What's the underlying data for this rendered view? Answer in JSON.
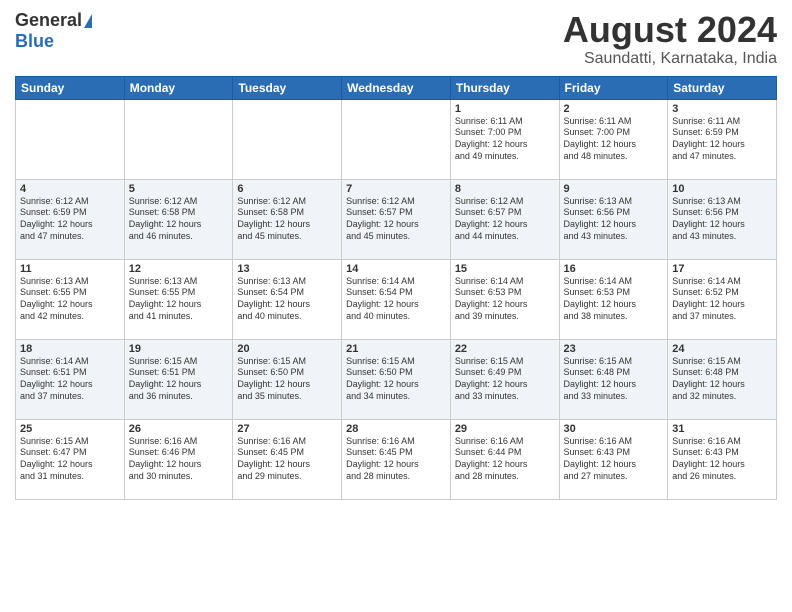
{
  "header": {
    "logo_general": "General",
    "logo_blue": "Blue",
    "month_title": "August 2024",
    "location": "Saundatti, Karnataka, India"
  },
  "days_of_week": [
    "Sunday",
    "Monday",
    "Tuesday",
    "Wednesday",
    "Thursday",
    "Friday",
    "Saturday"
  ],
  "weeks": [
    [
      {
        "day": "",
        "info": ""
      },
      {
        "day": "",
        "info": ""
      },
      {
        "day": "",
        "info": ""
      },
      {
        "day": "",
        "info": ""
      },
      {
        "day": "1",
        "info": "Sunrise: 6:11 AM\nSunset: 7:00 PM\nDaylight: 12 hours\nand 49 minutes."
      },
      {
        "day": "2",
        "info": "Sunrise: 6:11 AM\nSunset: 7:00 PM\nDaylight: 12 hours\nand 48 minutes."
      },
      {
        "day": "3",
        "info": "Sunrise: 6:11 AM\nSunset: 6:59 PM\nDaylight: 12 hours\nand 47 minutes."
      }
    ],
    [
      {
        "day": "4",
        "info": "Sunrise: 6:12 AM\nSunset: 6:59 PM\nDaylight: 12 hours\nand 47 minutes."
      },
      {
        "day": "5",
        "info": "Sunrise: 6:12 AM\nSunset: 6:58 PM\nDaylight: 12 hours\nand 46 minutes."
      },
      {
        "day": "6",
        "info": "Sunrise: 6:12 AM\nSunset: 6:58 PM\nDaylight: 12 hours\nand 45 minutes."
      },
      {
        "day": "7",
        "info": "Sunrise: 6:12 AM\nSunset: 6:57 PM\nDaylight: 12 hours\nand 45 minutes."
      },
      {
        "day": "8",
        "info": "Sunrise: 6:12 AM\nSunset: 6:57 PM\nDaylight: 12 hours\nand 44 minutes."
      },
      {
        "day": "9",
        "info": "Sunrise: 6:13 AM\nSunset: 6:56 PM\nDaylight: 12 hours\nand 43 minutes."
      },
      {
        "day": "10",
        "info": "Sunrise: 6:13 AM\nSunset: 6:56 PM\nDaylight: 12 hours\nand 43 minutes."
      }
    ],
    [
      {
        "day": "11",
        "info": "Sunrise: 6:13 AM\nSunset: 6:55 PM\nDaylight: 12 hours\nand 42 minutes."
      },
      {
        "day": "12",
        "info": "Sunrise: 6:13 AM\nSunset: 6:55 PM\nDaylight: 12 hours\nand 41 minutes."
      },
      {
        "day": "13",
        "info": "Sunrise: 6:13 AM\nSunset: 6:54 PM\nDaylight: 12 hours\nand 40 minutes."
      },
      {
        "day": "14",
        "info": "Sunrise: 6:14 AM\nSunset: 6:54 PM\nDaylight: 12 hours\nand 40 minutes."
      },
      {
        "day": "15",
        "info": "Sunrise: 6:14 AM\nSunset: 6:53 PM\nDaylight: 12 hours\nand 39 minutes."
      },
      {
        "day": "16",
        "info": "Sunrise: 6:14 AM\nSunset: 6:53 PM\nDaylight: 12 hours\nand 38 minutes."
      },
      {
        "day": "17",
        "info": "Sunrise: 6:14 AM\nSunset: 6:52 PM\nDaylight: 12 hours\nand 37 minutes."
      }
    ],
    [
      {
        "day": "18",
        "info": "Sunrise: 6:14 AM\nSunset: 6:51 PM\nDaylight: 12 hours\nand 37 minutes."
      },
      {
        "day": "19",
        "info": "Sunrise: 6:15 AM\nSunset: 6:51 PM\nDaylight: 12 hours\nand 36 minutes."
      },
      {
        "day": "20",
        "info": "Sunrise: 6:15 AM\nSunset: 6:50 PM\nDaylight: 12 hours\nand 35 minutes."
      },
      {
        "day": "21",
        "info": "Sunrise: 6:15 AM\nSunset: 6:50 PM\nDaylight: 12 hours\nand 34 minutes."
      },
      {
        "day": "22",
        "info": "Sunrise: 6:15 AM\nSunset: 6:49 PM\nDaylight: 12 hours\nand 33 minutes."
      },
      {
        "day": "23",
        "info": "Sunrise: 6:15 AM\nSunset: 6:48 PM\nDaylight: 12 hours\nand 33 minutes."
      },
      {
        "day": "24",
        "info": "Sunrise: 6:15 AM\nSunset: 6:48 PM\nDaylight: 12 hours\nand 32 minutes."
      }
    ],
    [
      {
        "day": "25",
        "info": "Sunrise: 6:15 AM\nSunset: 6:47 PM\nDaylight: 12 hours\nand 31 minutes."
      },
      {
        "day": "26",
        "info": "Sunrise: 6:16 AM\nSunset: 6:46 PM\nDaylight: 12 hours\nand 30 minutes."
      },
      {
        "day": "27",
        "info": "Sunrise: 6:16 AM\nSunset: 6:45 PM\nDaylight: 12 hours\nand 29 minutes."
      },
      {
        "day": "28",
        "info": "Sunrise: 6:16 AM\nSunset: 6:45 PM\nDaylight: 12 hours\nand 28 minutes."
      },
      {
        "day": "29",
        "info": "Sunrise: 6:16 AM\nSunset: 6:44 PM\nDaylight: 12 hours\nand 28 minutes."
      },
      {
        "day": "30",
        "info": "Sunrise: 6:16 AM\nSunset: 6:43 PM\nDaylight: 12 hours\nand 27 minutes."
      },
      {
        "day": "31",
        "info": "Sunrise: 6:16 AM\nSunset: 6:43 PM\nDaylight: 12 hours\nand 26 minutes."
      }
    ]
  ]
}
